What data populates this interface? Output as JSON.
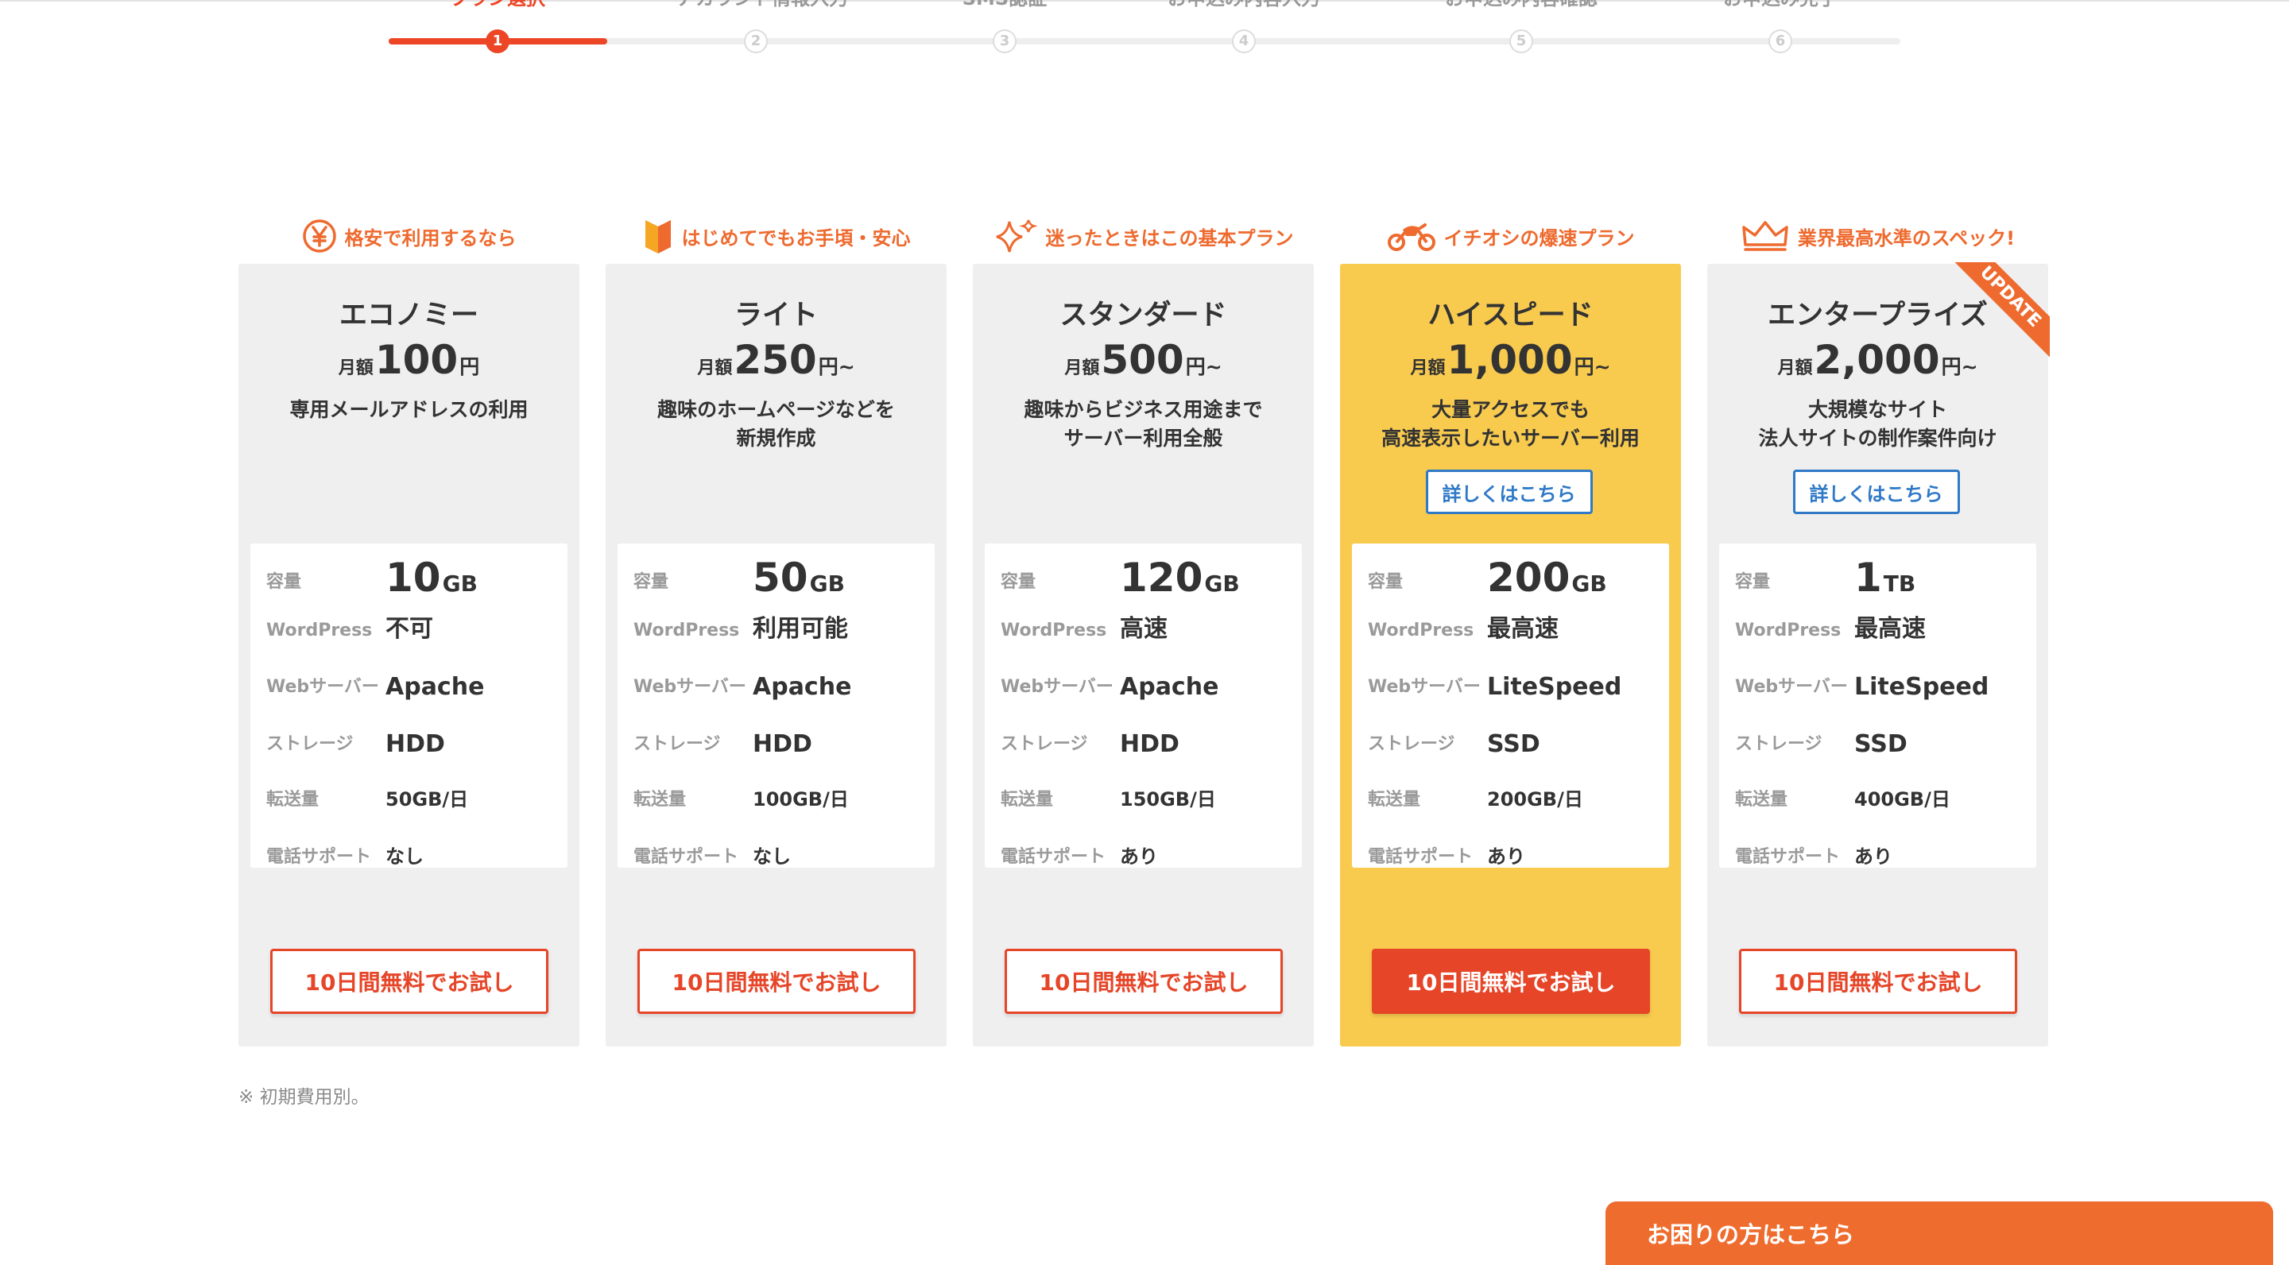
{
  "stepper": {
    "active_step": 1,
    "steps": [
      {
        "number": "1",
        "label": "プラン選択"
      },
      {
        "number": "2",
        "label": "アカウント情報入力"
      },
      {
        "number": "3",
        "label": "SMS認証"
      },
      {
        "number": "4",
        "label": "お申込み内容入力"
      },
      {
        "number": "5",
        "label": "お申込み内容確認"
      },
      {
        "number": "6",
        "label": "お申込み完了"
      }
    ]
  },
  "plans": [
    {
      "tagline": "格安で利用するなら",
      "tag_icon": "yen-icon",
      "name": "エコノミー",
      "price_prefix": "月額",
      "price": "100",
      "price_suffix": "円",
      "desc": [
        "専用メールアドレスの利用",
        ""
      ],
      "detail_button": "",
      "specs": {
        "capacity_num": "10",
        "capacity_unit": "GB",
        "wordpress": "不可",
        "webserver": "Apache",
        "storage": "HDD",
        "transfer": "50GB/日",
        "phone": "なし"
      },
      "trial_button": "10日間無料でお試し"
    },
    {
      "tagline": "はじめてでもお手頃・安心",
      "tag_icon": "beginner-mark-icon",
      "name": "ライト",
      "price_prefix": "月額",
      "price": "250",
      "price_suffix": "円~",
      "desc": [
        "趣味のホームページなどを",
        "新規作成"
      ],
      "detail_button": "",
      "specs": {
        "capacity_num": "50",
        "capacity_unit": "GB",
        "wordpress": "利用可能",
        "webserver": "Apache",
        "storage": "HDD",
        "transfer": "100GB/日",
        "phone": "なし"
      },
      "trial_button": "10日間無料でお試し"
    },
    {
      "tagline": "迷ったときはこの基本プラン",
      "tag_icon": "sparkle-icon",
      "name": "スタンダード",
      "price_prefix": "月額",
      "price": "500",
      "price_suffix": "円~",
      "desc": [
        "趣味からビジネス用途まで",
        "サーバー利用全般"
      ],
      "detail_button": "",
      "specs": {
        "capacity_num": "120",
        "capacity_unit": "GB",
        "wordpress": "高速",
        "webserver": "Apache",
        "storage": "HDD",
        "transfer": "150GB/日",
        "phone": "あり"
      },
      "trial_button": "10日間無料でお試し"
    },
    {
      "tagline": "イチオシの爆速プラン",
      "tag_icon": "motorcycle-icon",
      "name": "ハイスピード",
      "price_prefix": "月額",
      "price": "1,000",
      "price_suffix": "円~",
      "desc": [
        "大量アクセスでも",
        "高速表示したいサーバー利用"
      ],
      "detail_button": "詳しくはこちら",
      "specs": {
        "capacity_num": "200",
        "capacity_unit": "GB",
        "wordpress": "最高速",
        "webserver": "LiteSpeed",
        "storage": "SSD",
        "transfer": "200GB/日",
        "phone": "あり"
      },
      "trial_button": "10日間無料でお試し"
    },
    {
      "tagline": "業界最高水準のスペック!",
      "tag_icon": "crown-icon",
      "name": "エンタープライズ",
      "price_prefix": "月額",
      "price": "2,000",
      "price_suffix": "円~",
      "desc": [
        "大規模なサイト",
        "法人サイトの制作案件向け"
      ],
      "detail_button": "詳しくはこちら",
      "badge": "UPDATE",
      "specs": {
        "capacity_num": "1",
        "capacity_unit": "TB",
        "wordpress": "最高速",
        "webserver": "LiteSpeed",
        "storage": "SSD",
        "transfer": "400GB/日",
        "phone": "あり"
      },
      "trial_button": "10日間無料でお試し"
    }
  ],
  "spec_labels": {
    "capacity": "容量",
    "wordpress": "WordPress",
    "webserver": "Webサーバー",
    "storage": "ストレージ",
    "transfer": "転送量",
    "phone": "電話サポート"
  },
  "footnote": "※ 初期費用別。",
  "help_tab": "お困りの方はこちら",
  "colors": {
    "accent": "#ec4626",
    "tagline": "#ee6a2e",
    "featured_card": "#f8cb4f",
    "card": "#efefef",
    "detail_button": "#2f79c7"
  }
}
